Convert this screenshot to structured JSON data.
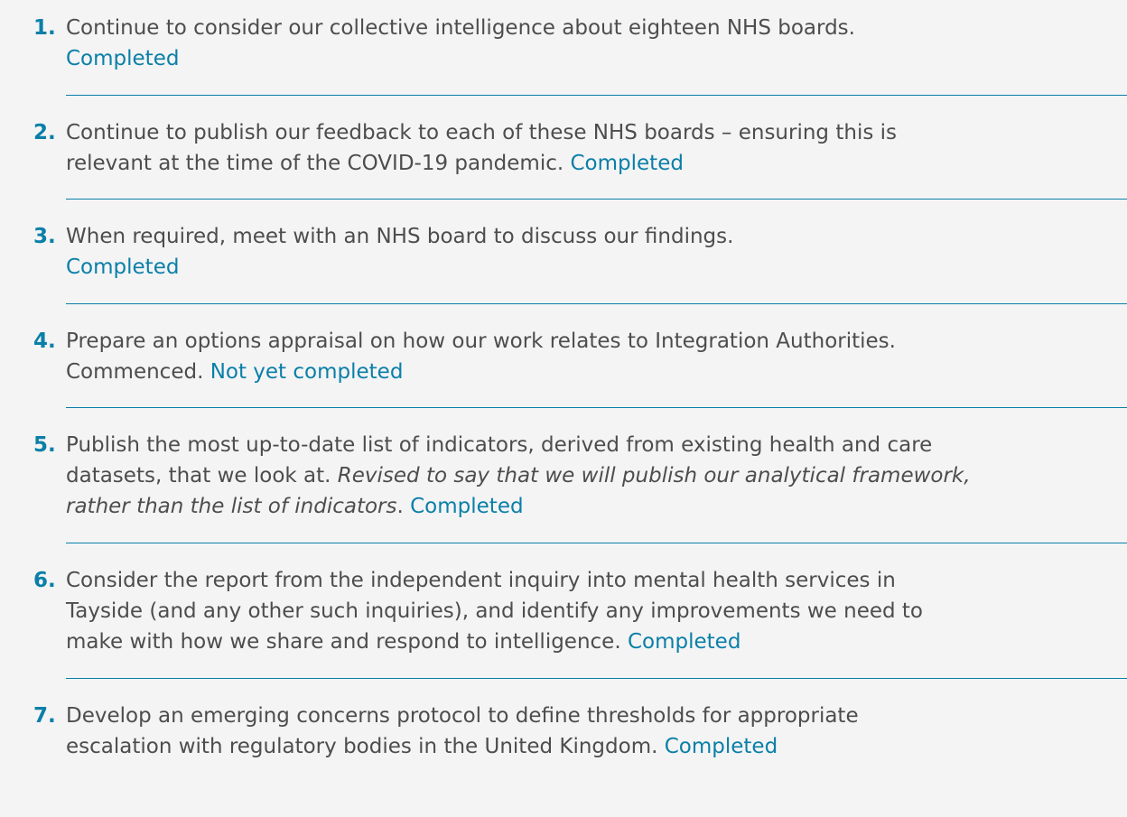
{
  "items": [
    {
      "number": "1.",
      "line1": "Continue to consider our collective intelligence about eighteen NHS boards.",
      "status": "Completed"
    },
    {
      "number": "2.",
      "line1": "Continue to publish our feedback to each of these NHS boards – ensuring this is",
      "line2": "relevant at the time of the COVID-19 pandemic.",
      "status": "Completed"
    },
    {
      "number": "3.",
      "line1": "When required, meet with an NHS board to discuss our findings.",
      "status": "Completed"
    },
    {
      "number": "4.",
      "line1": "Prepare an options appraisal on how our work relates to Integration Authorities.",
      "line2": "Commenced.",
      "status": "Not yet completed"
    },
    {
      "number": "5.",
      "line1": "Publish the most up-to-date list of indicators, derived from existing health and care",
      "line2": "datasets, that we look at.",
      "italic_a": "Revised to say that we will publish our analytical framework,",
      "italic_b": "rather than the list of indicators",
      "after_italic": ".",
      "status": "Completed"
    },
    {
      "number": "6.",
      "line1": "Consider the report from the independent inquiry into mental health services in",
      "line2": "Tayside (and any other such inquiries), and identify any improvements we need to",
      "line3": "make with how we share and respond to intelligence.",
      "status": "Completed"
    },
    {
      "number": "7.",
      "line1": "Develop an emerging concerns protocol to define thresholds for appropriate",
      "line2": "escalation with regulatory bodies in the United Kingdom.",
      "status": "Completed"
    }
  ]
}
